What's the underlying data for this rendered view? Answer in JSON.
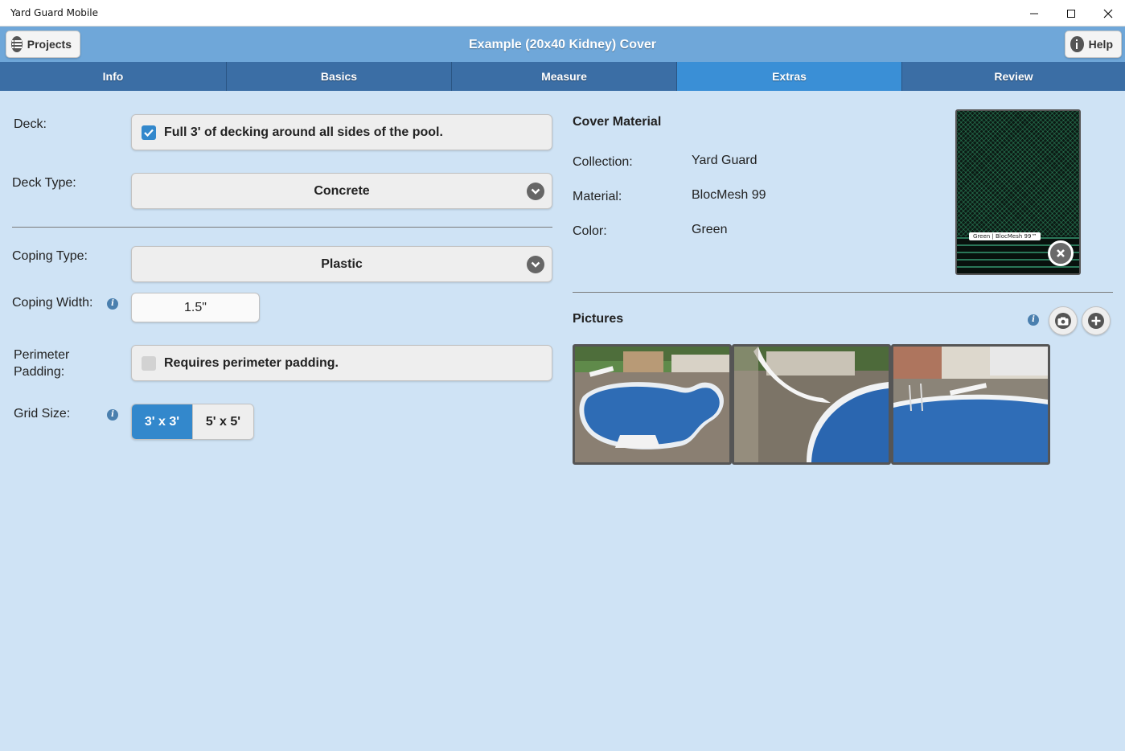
{
  "window": {
    "title": "Yard Guard Mobile"
  },
  "header": {
    "title": "Example (20x40 Kidney) Cover",
    "projects_label": "Projects",
    "help_label": "Help"
  },
  "tabs": [
    {
      "label": "Info"
    },
    {
      "label": "Basics"
    },
    {
      "label": "Measure"
    },
    {
      "label": "Extras"
    },
    {
      "label": "Review"
    }
  ],
  "form": {
    "deck_label": "Deck:",
    "deck_checkbox_label": "Full 3' of decking around all sides of the pool.",
    "deck_checked": true,
    "deck_type_label": "Deck Type:",
    "deck_type_value": "Concrete",
    "coping_type_label": "Coping Type:",
    "coping_type_value": "Plastic",
    "coping_width_label": "Coping Width:",
    "coping_width_value": "1.5\"",
    "perimeter_label_line1": "Perimeter",
    "perimeter_label_line2": "Padding:",
    "perimeter_checkbox_label": "Requires perimeter padding.",
    "perimeter_checked": false,
    "grid_size_label": "Grid Size:",
    "grid_options": [
      "3' x 3'",
      "5' x 5'"
    ],
    "grid_selected": "3' x 3'"
  },
  "cover_material": {
    "heading": "Cover Material",
    "collection_label": "Collection:",
    "collection_value": "Yard Guard",
    "material_label": "Material:",
    "material_value": "BlocMesh 99",
    "color_label": "Color:",
    "color_value": "Green",
    "swatch_tag": "Green | BlocMesh 99™"
  },
  "pictures": {
    "heading": "Pictures"
  },
  "colors": {
    "header": "#6fa7d9",
    "tab": "#3b6ea5",
    "tab_active": "#3a8fd6",
    "background": "#cfe3f5",
    "accent": "#3388cc"
  }
}
